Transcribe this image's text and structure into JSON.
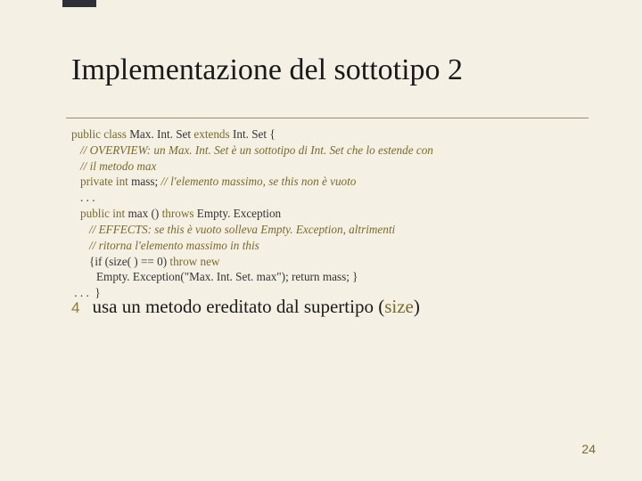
{
  "title": "Implementazione del sottotipo 2",
  "code": {
    "l1_a": "public class",
    "l1_b": " Max. Int. Set ",
    "l1_c": "extends",
    "l1_d": " Int. Set {",
    "l2": "// OVERVIEW: un Max. Int. Set è un sottotipo di Int. Set che lo estende con",
    "l3": "// il metodo max",
    "l4_a": "private int",
    "l4_b": " mass; ",
    "l4_c": "// l'elemento massimo, se this non è vuoto",
    "l5": ". . .",
    "l6_a": "public int",
    "l6_b": " max () ",
    "l6_c": "throws",
    "l6_d": " Empty. Exception",
    "l7": "// EFFECTS: se this è vuoto solleva Empty. Exception, altrimenti",
    "l8": "// ritorna l'elemento massimo in this",
    "l9_a": "{if (size( ) == 0) ",
    "l9_b": "throw new",
    "l10": "Empty. Exception(\"Max. Int. Set. max\"); return mass; }",
    "l11": " . . .  }"
  },
  "bullet": {
    "num": "4",
    "text_a": "usa un metodo ereditato dal supertipo (",
    "text_b": "size",
    "text_c": ")"
  },
  "page_number": "24"
}
